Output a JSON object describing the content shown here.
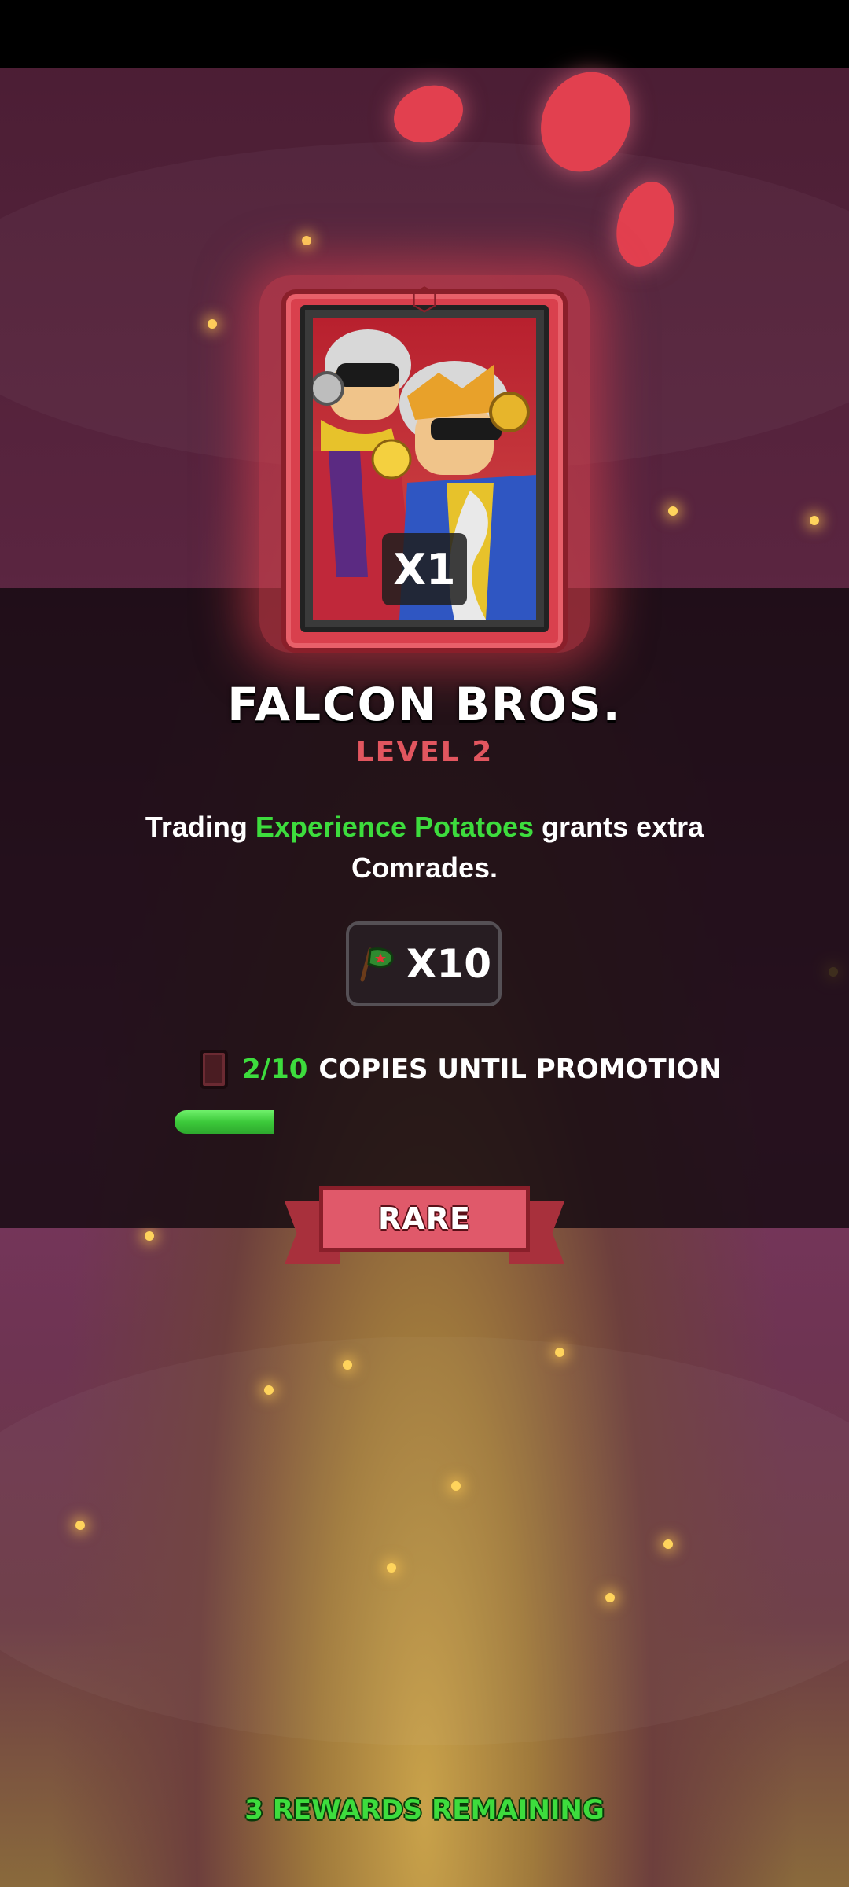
{
  "card": {
    "count": "X1",
    "name": "FALCON BROS.",
    "level": "LEVEL 2",
    "emblem_icon": "d20-dice-icon",
    "frame_color": "#d9404d"
  },
  "description": {
    "before": "Trading ",
    "highlight": "Experience Potatoes",
    "after": " grants extra Comrades."
  },
  "reward": {
    "icon": "comrade-flag-icon",
    "quantity": "X10"
  },
  "promotion": {
    "count": "2/10",
    "label": "COPIES UNTIL PROMOTION",
    "progress_fraction": 0.2
  },
  "rarity": {
    "label": "RARE"
  },
  "footer": {
    "remaining": "3 REWARDS REMAINING"
  },
  "colors": {
    "highlight_green": "#3ddc3d",
    "level_red": "#e2565f",
    "rare_red": "#e0596a"
  }
}
